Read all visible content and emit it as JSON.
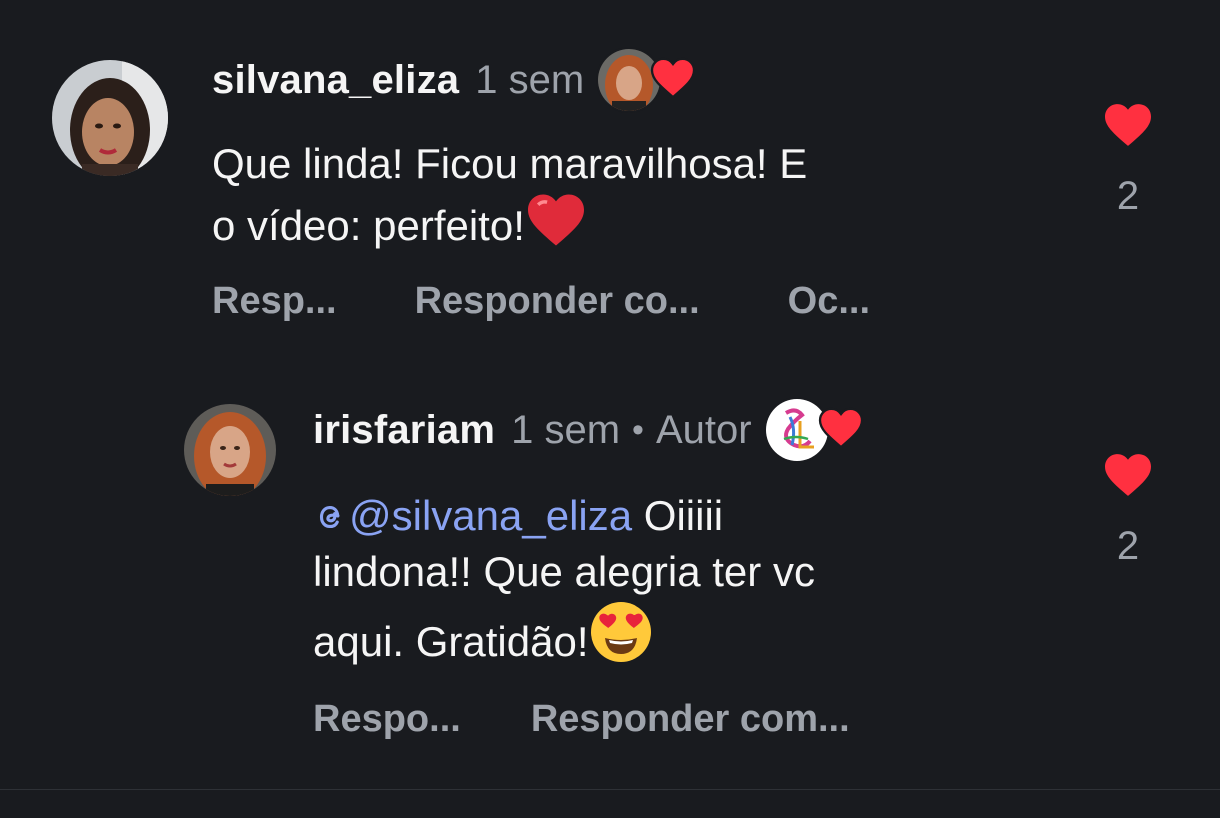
{
  "colors": {
    "background": "#191b1f",
    "text_primary": "#f5f5f5",
    "text_secondary": "#9ea3ab",
    "mention": "#8aa3f3",
    "like_red": "#ff3040"
  },
  "comments": [
    {
      "username": "silvana_eliza",
      "time": "1 sem",
      "author_label": "",
      "text_line1": "Que linda! Ficou maravilhosa! E",
      "text_line2": "o vídeo: perfeito!",
      "emoji": "red-heart-emoji",
      "like_icon": "heart-icon",
      "like_count": "2",
      "liked_by_creator_icon": "avatar-with-heart-icon",
      "actions": [
        "Resp...",
        "Responder co...",
        "Oc..."
      ]
    },
    {
      "username": "irisfariam",
      "time": "1 sem",
      "dot": "•",
      "author_label": "Autor",
      "mention": "@silvana_eliza",
      "text_line1_after": " Oiiiii",
      "text_line2": "lindona!! Que alegria ter vc",
      "text_line3": "aqui. Gratidão!",
      "emoji": "heart-eyes-emoji",
      "like_icon": "heart-icon",
      "like_count": "2",
      "liked_by_creator_icon": "logo-with-heart-icon",
      "actions": [
        "Respo...",
        "Responder com..."
      ]
    }
  ]
}
